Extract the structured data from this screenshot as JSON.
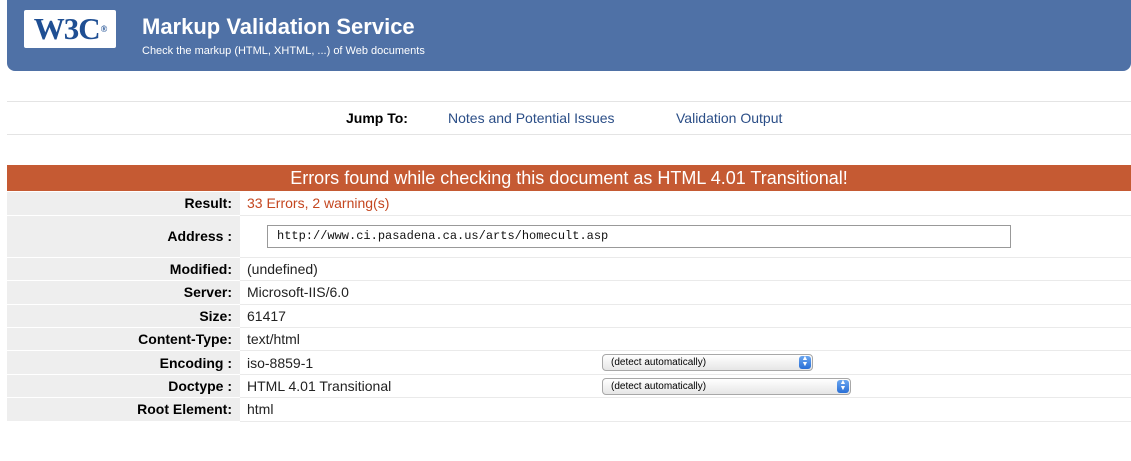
{
  "banner": {
    "logo_text": "W3C",
    "logo_mark": "®",
    "title": "Markup Validation Service",
    "subtitle": "Check the markup (HTML, XHTML, ...) of Web documents"
  },
  "jump": {
    "label": "Jump To:",
    "links": [
      "Notes and Potential Issues",
      "Validation Output"
    ]
  },
  "result_header": "Errors found while checking this document as HTML 4.01 Transitional!",
  "rows": {
    "result": {
      "label": "Result:",
      "value": "33 Errors, 2 warning(s)"
    },
    "address": {
      "label": "Address :",
      "value": "http://www.ci.pasadena.ca.us/arts/homecult.asp"
    },
    "modified": {
      "label": "Modified:",
      "value": "(undefined)"
    },
    "server": {
      "label": "Server:",
      "value": "Microsoft-IIS/6.0"
    },
    "size": {
      "label": "Size:",
      "value": "61417"
    },
    "content_type": {
      "label": "Content-Type:",
      "value": "text/html"
    },
    "encoding": {
      "label": "Encoding :",
      "value": "iso-8859-1",
      "select": "(detect automatically)"
    },
    "doctype": {
      "label": "Doctype :",
      "value": "HTML 4.01 Transitional",
      "select": "(detect automatically)"
    },
    "root_element": {
      "label": "Root Element:",
      "value": "html"
    }
  },
  "colors": {
    "banner": "#4f71a6",
    "error_header": "#c55a33",
    "link": "#2b4e87",
    "error_text": "#c4461f"
  }
}
